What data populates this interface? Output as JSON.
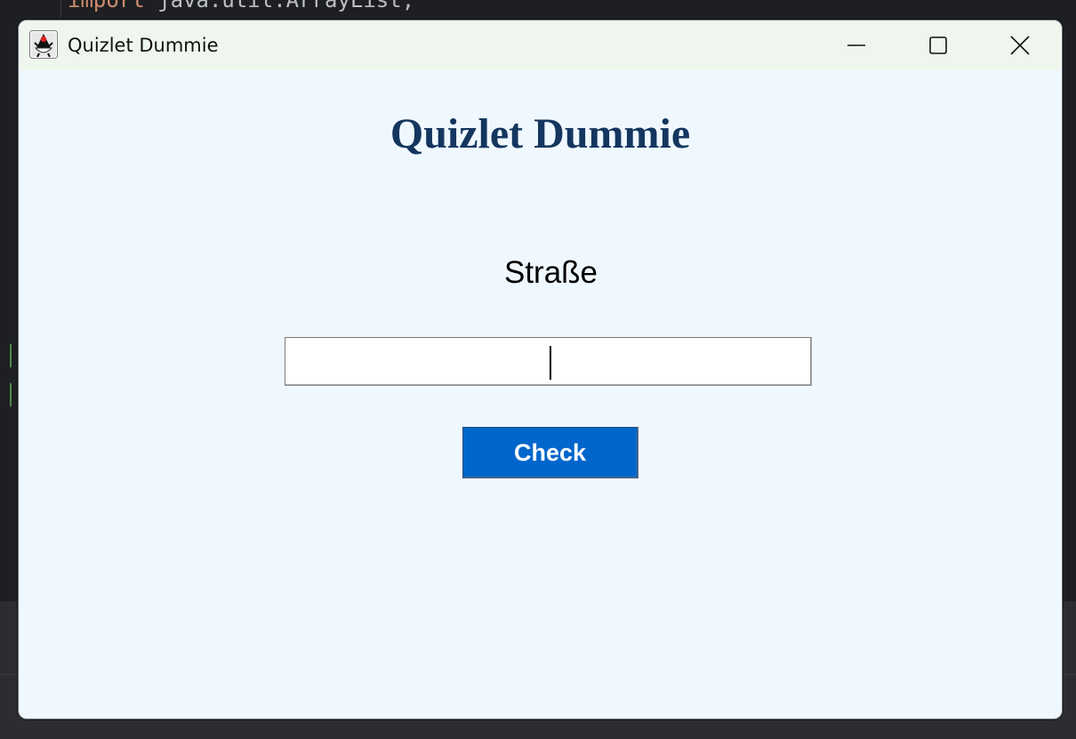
{
  "ide": {
    "code_keyword": "import",
    "code_rest": " java.util.ArrayList;"
  },
  "window": {
    "title": "Quizlet Dummie",
    "icon": "java-duke-icon",
    "controls": [
      "minimize-icon",
      "maximize-icon",
      "close-icon"
    ]
  },
  "main": {
    "heading": "Quizlet Dummie",
    "word": "Straße",
    "answer_value": "",
    "check_label": "Check"
  },
  "colors": {
    "heading": "#14365f",
    "button": "#0066cc",
    "background": "#f0f8ff"
  }
}
